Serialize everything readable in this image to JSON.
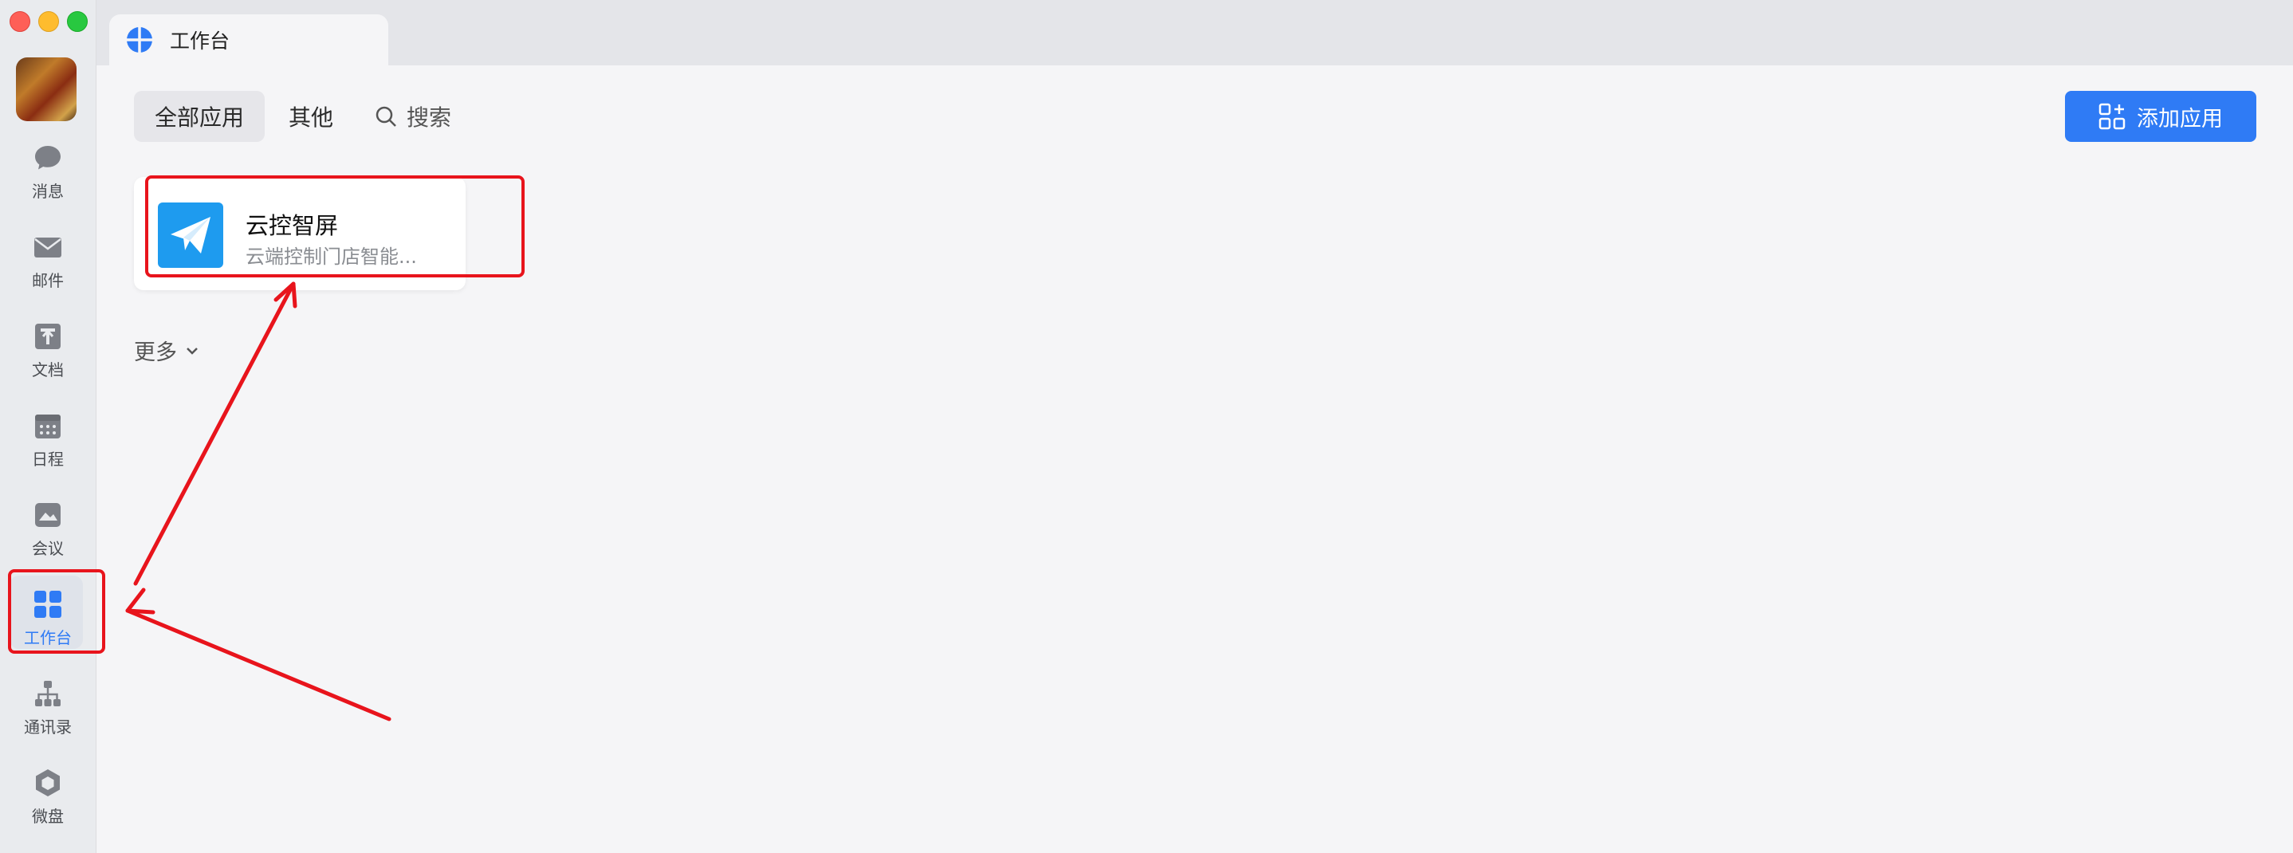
{
  "sidebar": {
    "items": [
      {
        "id": "messages",
        "label": "消息",
        "icon": "chat-bubble-icon"
      },
      {
        "id": "mail",
        "label": "邮件",
        "icon": "mail-icon"
      },
      {
        "id": "docs",
        "label": "文档",
        "icon": "document-icon"
      },
      {
        "id": "calendar",
        "label": "日程",
        "icon": "calendar-icon"
      },
      {
        "id": "meeting",
        "label": "会议",
        "icon": "meeting-icon"
      },
      {
        "id": "workbench",
        "label": "工作台",
        "icon": "grid-apps-icon",
        "active": true
      },
      {
        "id": "contacts",
        "label": "通讯录",
        "icon": "org-chart-icon"
      },
      {
        "id": "drive",
        "label": "微盘",
        "icon": "drive-icon"
      }
    ]
  },
  "tab": {
    "title": "工作台",
    "icon": "workbench-logo-icon"
  },
  "toolbar": {
    "all_apps": "全部应用",
    "other": "其他",
    "search": "搜索",
    "add_app": "添加应用"
  },
  "apps": [
    {
      "name": "云控智屏",
      "description": "云端控制门店智能...",
      "icon": "paper-plane-icon"
    }
  ],
  "more_label": "更多",
  "colors": {
    "accent": "#2f7bf5",
    "annotation": "#e8141c",
    "app_icon_bg": "#1e9bef"
  }
}
